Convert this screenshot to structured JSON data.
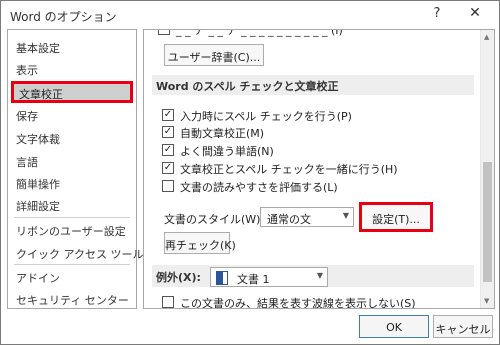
{
  "window": {
    "title": "Word のオプション",
    "help_glyph": "?",
    "close_glyph": "✕"
  },
  "sidebar": {
    "items": [
      {
        "label": "基本設定"
      },
      {
        "label": "表示"
      },
      {
        "label": "文章校正",
        "selected": true
      },
      {
        "label": "保存"
      },
      {
        "label": "文字体裁"
      },
      {
        "label": "言語"
      },
      {
        "label": "簡単操作"
      },
      {
        "label": "詳細設定"
      },
      {
        "label": "リボンのユーザー設定"
      },
      {
        "label": "クイック アクセス ツール バー"
      },
      {
        "label": "アドイン"
      },
      {
        "label": "セキュリティ センター"
      }
    ]
  },
  "content": {
    "partial_checkbox_label": "_ _ ア _ _ ア _ _ _ _ _ _ _ _ _ _ (I)",
    "user_dictionary_button": "ユーザー辞書(C)...",
    "spellcheck_section_title": "Word のスペル チェックと文章校正",
    "options": [
      {
        "label": "入力時にスペル チェックを行う(P)",
        "checked": true
      },
      {
        "label": "自動文章校正(M)",
        "checked": true
      },
      {
        "label": "よく間違う単語(N)",
        "checked": true
      },
      {
        "label": "文章校正とスペル チェックを一緒に行う(H)",
        "checked": true
      },
      {
        "label": "文書の読みやすさを評価する(L)",
        "checked": false
      }
    ],
    "writing_style_label": "文書のスタイル(W):",
    "writing_style_value": "通常の文",
    "settings_button": "設定(T)...",
    "recheck_button": "再チェック(K)",
    "exceptions_label": "例外(X):",
    "exceptions_document": "文書 1",
    "hide_errors_label": "この文書のみ、結果を表す波線を表示しない(S)",
    "hide_errors_checked": false
  },
  "footer": {
    "ok_label": "OK",
    "cancel_label": "キャンセル"
  },
  "colors": {
    "highlight_border": "#e60012",
    "selected_bg": "#cfcfcf",
    "section_bg": "#eeeeee"
  }
}
